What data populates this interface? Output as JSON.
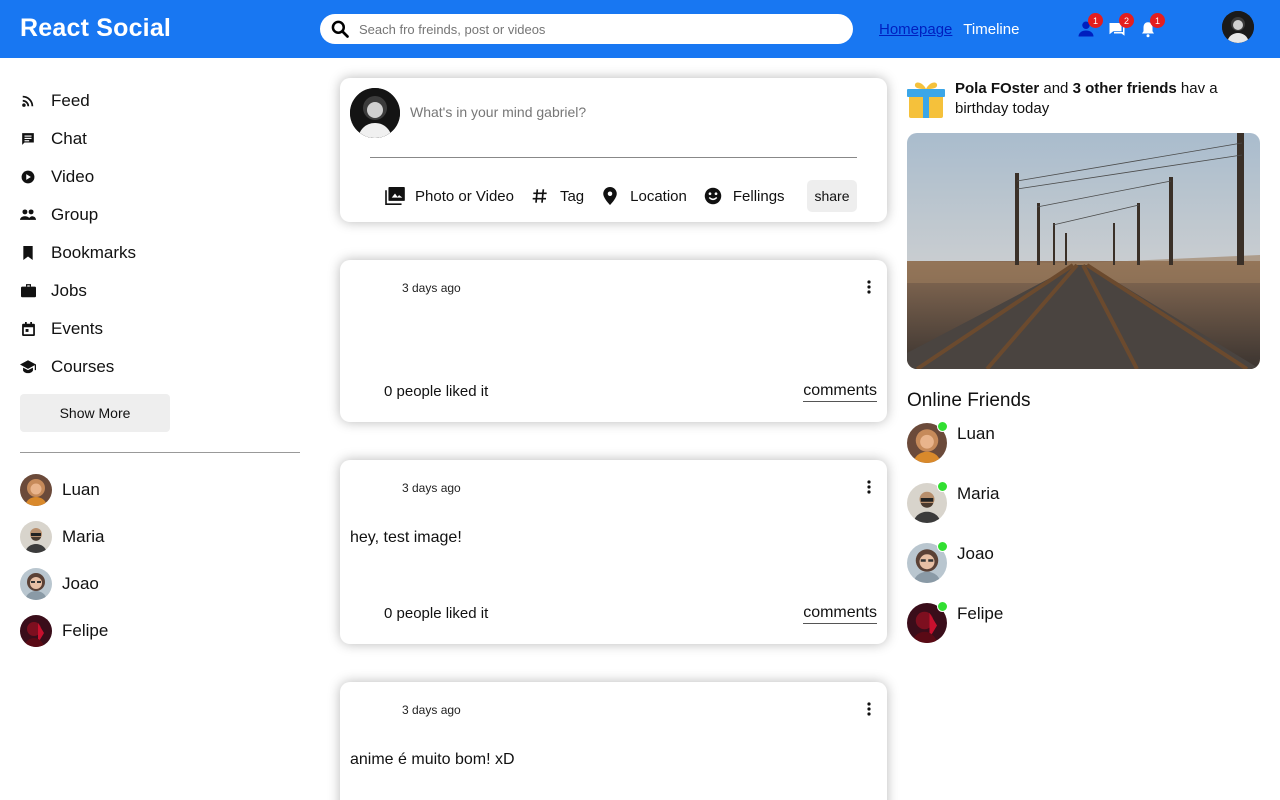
{
  "topbar": {
    "logo": "React Social",
    "search_placeholder": "Seach fro freinds, post or videos",
    "links": [
      "Homepage",
      "Timeline"
    ],
    "badges": {
      "friends": "1",
      "messages": "2",
      "notifications": "1"
    }
  },
  "sidebar": {
    "items": [
      {
        "label": "Feed",
        "icon": "rss-feed-icon"
      },
      {
        "label": "Chat",
        "icon": "chat-icon"
      },
      {
        "label": "Video",
        "icon": "play-circle-icon"
      },
      {
        "label": "Group",
        "icon": "group-icon"
      },
      {
        "label": "Bookmarks",
        "icon": "bookmark-icon"
      },
      {
        "label": "Jobs",
        "icon": "briefcase-icon"
      },
      {
        "label": "Events",
        "icon": "calendar-icon"
      },
      {
        "label": "Courses",
        "icon": "school-icon"
      }
    ],
    "show_more": "Show More",
    "friends": [
      "Luan",
      "Maria",
      "Joao",
      "Felipe"
    ]
  },
  "share": {
    "placeholder": "What's in your mind gabriel?",
    "options": [
      "Photo or Video",
      "Tag",
      "Location",
      "Fellings"
    ],
    "button": "share"
  },
  "posts": [
    {
      "date": "3 days ago",
      "text": "",
      "likes": "0 people liked it",
      "comments": "comments"
    },
    {
      "date": "3 days ago",
      "text": "hey, test image!",
      "likes": "0 people liked it",
      "comments": "comments"
    },
    {
      "date": "3 days ago",
      "text": "anime é muito bom! xD",
      "likes": "",
      "comments": ""
    }
  ],
  "rightbar": {
    "birthday_name": "Pola FOster",
    "birthday_and": " and ",
    "birthday_others": "3 other friends",
    "birthday_rest": " hav a birthday today",
    "online_title": "Online Friends",
    "online_friends": [
      "Luan",
      "Maria",
      "Joao",
      "Felipe"
    ]
  },
  "colors": {
    "brand": "#1877f2",
    "badge": "#e41e1e",
    "online": "#32df32",
    "active_link": "#001fbf"
  }
}
